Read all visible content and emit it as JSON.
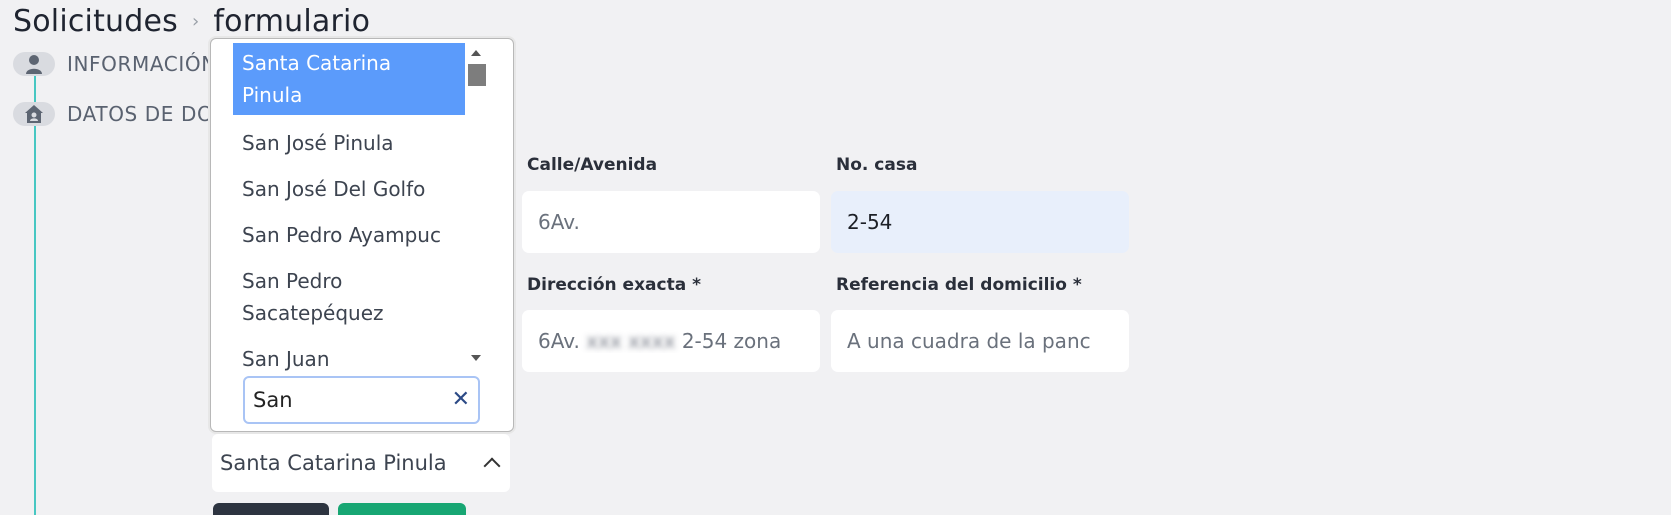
{
  "breadcrumb": {
    "root": "Solicitudes",
    "separator": "›",
    "current": "formulario"
  },
  "steps": [
    {
      "label": "INFORMACIÓN",
      "icon": "user-icon"
    },
    {
      "label": "DATOS DE DOMICILIO",
      "icon": "home-icon"
    }
  ],
  "dropdown": {
    "options": [
      "Santa Catarina Pinula",
      "San José Pinula",
      "San José Del Golfo",
      "San Pedro Ayampuc",
      "San Pedro Sacatepéquez",
      "San Juan"
    ],
    "selected_index": 0,
    "search_value": "San"
  },
  "municipio_select": {
    "value": "Santa Catarina Pinula"
  },
  "form": {
    "calle_label": "Calle/Avenida",
    "calle_value": "6Av.",
    "no_casa_label": "No. casa",
    "no_casa_value": "2-54",
    "direccion_label": "Dirección exacta *",
    "direccion_prefix": "6Av.",
    "direccion_suffix": "2-54 zona",
    "referencia_label": "Referencia del domicilio *",
    "referencia_value": "A una cuadra de la panc"
  },
  "colors": {
    "accent": "#5b9bfb",
    "timeline": "#47c7c2",
    "button_dark": "#2d3440",
    "button_green": "#17a673"
  }
}
